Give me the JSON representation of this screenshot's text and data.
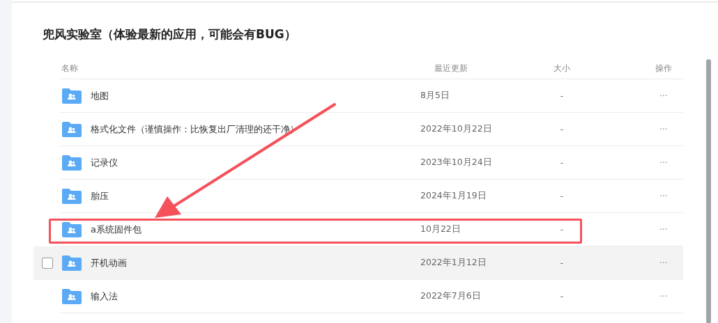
{
  "title": "兜风实验室（体验最新的应用，可能会有BUG）",
  "table": {
    "columns": [
      "名称",
      "最近更新",
      "大小",
      "操作"
    ],
    "rows": [
      {
        "name": "地图",
        "updated": "8月5日",
        "size": "-",
        "actions": "···",
        "hovered": false,
        "highlighted": false
      },
      {
        "name": "格式化文件（谨慎操作：比恢复出厂清理的还干净）",
        "updated": "2022年10月22日",
        "size": "-",
        "actions": "···",
        "hovered": false,
        "highlighted": false
      },
      {
        "name": "记录仪",
        "updated": "2023年10月24日",
        "size": "-",
        "actions": "···",
        "hovered": false,
        "highlighted": false
      },
      {
        "name": "胎压",
        "updated": "2024年1月19日",
        "size": "-",
        "actions": "···",
        "hovered": false,
        "highlighted": false
      },
      {
        "name": "a系统固件包",
        "updated": "10月22日",
        "size": "-",
        "actions": "···",
        "hovered": false,
        "highlighted": true
      },
      {
        "name": "开机动画",
        "updated": "2022年1月12日",
        "size": "-",
        "actions": "···",
        "hovered": true,
        "highlighted": false
      },
      {
        "name": "输入法",
        "updated": "2022年7月6日",
        "size": "-",
        "actions": "···",
        "hovered": false,
        "highlighted": false
      }
    ]
  }
}
